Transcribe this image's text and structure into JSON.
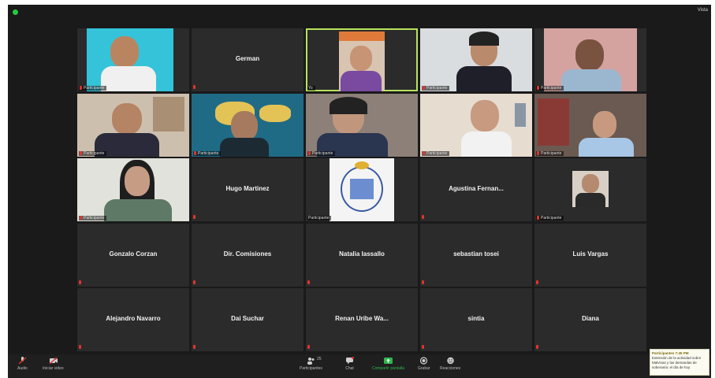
{
  "window": {
    "view_label": "Vista"
  },
  "tiles": [
    {
      "video_label": "Participante"
    },
    {
      "name": "German"
    },
    {
      "video_label": "Yo"
    },
    {
      "video_label": "Participante"
    },
    {
      "video_label": "Participante"
    },
    {
      "video_label": "Participante"
    },
    {
      "video_label": "Participante"
    },
    {
      "video_label": "Participante"
    },
    {
      "video_label": "Participante"
    },
    {
      "video_label": "Participante"
    },
    {
      "video_label": "Participante"
    },
    {
      "name": "Hugo Martinez"
    },
    {
      "video_label": "Participante"
    },
    {
      "name": "Agustina Fernan..."
    },
    {
      "video_label": "Participante"
    },
    {
      "name": "Gonzalo Corzan"
    },
    {
      "name": "Dir. Comisiones"
    },
    {
      "name": "Natalia Iassallo"
    },
    {
      "name": "sebastian tosei"
    },
    {
      "name": "Luis Vargas"
    },
    {
      "name": "Alejandro Navarro"
    },
    {
      "name": "Dai Suchar"
    },
    {
      "name": "Renan Uribe Wa..."
    },
    {
      "name": "sintia"
    },
    {
      "name": "Diana"
    }
  ],
  "controls": {
    "audio": "Audio",
    "video": "Iniciar video",
    "participants": "Participantes",
    "participants_count": "25",
    "chat": "Chat",
    "share": "Compartir pantalla",
    "record": "Grabar",
    "reactions": "Reacciones"
  },
  "chat_popup": {
    "header": "Participantes 7:45 PM",
    "lines": [
      "Extensión de la actividad sobre",
      "Malvinas y las demandas de",
      "soberanía: el día de hoy"
    ]
  }
}
